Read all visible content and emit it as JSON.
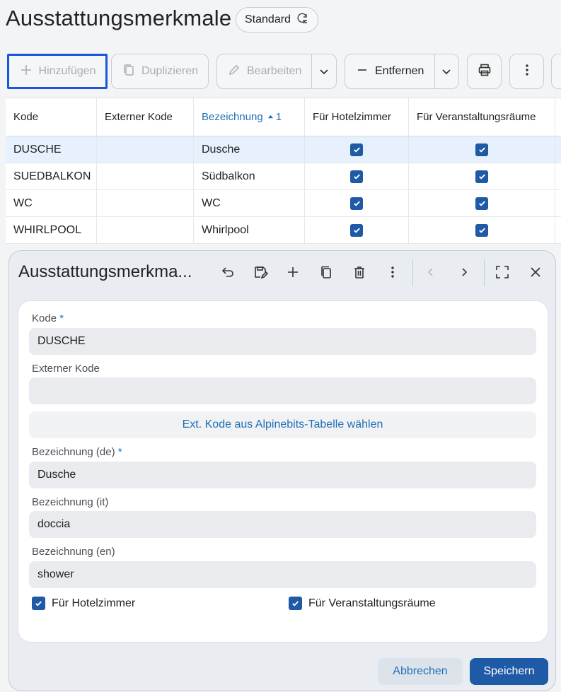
{
  "page": {
    "title": "Ausstattungsmerkmale",
    "view_chip": "Standard"
  },
  "toolbar": {
    "add": "Hinzufügen",
    "duplicate": "Duplizieren",
    "edit": "Bearbeiten",
    "remove": "Entfernen"
  },
  "grid": {
    "columns": [
      "Kode",
      "Externer Kode",
      "Bezeichnung",
      "Für Hotelzimmer",
      "Für Veranstaltungsräume"
    ],
    "sort_index": "1",
    "rows": [
      {
        "kode": "DUSCHE",
        "ext": "",
        "bez": "Dusche",
        "hotel": true,
        "event": true
      },
      {
        "kode": "SUEDBALKON",
        "ext": "",
        "bez": "Südbalkon",
        "hotel": true,
        "event": true
      },
      {
        "kode": "WC",
        "ext": "",
        "bez": "WC",
        "hotel": true,
        "event": true
      },
      {
        "kode": "WHIRLPOOL",
        "ext": "",
        "bez": "Whirlpool",
        "hotel": true,
        "event": true
      }
    ]
  },
  "dialog": {
    "title": "Ausstattungsmerkma...",
    "fields": {
      "kode_label": "Kode",
      "kode_value": "DUSCHE",
      "ext_label": "Externer Kode",
      "ext_value": "",
      "ext_button": "Ext. Kode aus Alpinebits-Tabelle wählen",
      "bez_de_label": "Bezeichnung (de)",
      "bez_de_value": "Dusche",
      "bez_it_label": "Bezeichnung (it)",
      "bez_it_value": "doccia",
      "bez_en_label": "Bezeichnung (en)",
      "bez_en_value": "shower",
      "cb_hotel": "Für Hotelzimmer",
      "cb_event": "Für Veranstaltungsräume",
      "required_mark": "*"
    },
    "cancel": "Abbrechen",
    "save": "Speichern"
  },
  "colors": {
    "accent": "#1f5aa6",
    "link": "#1f6fb5",
    "focus": "#1a56db",
    "selected_row": "#e7f0fd"
  }
}
